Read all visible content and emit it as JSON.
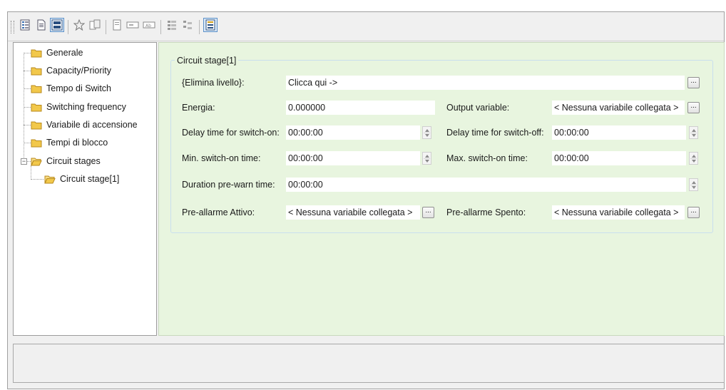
{
  "toolbar": {
    "buttons": [
      "tree-view-icon",
      "document-icon",
      "panel-view-icon",
      "star-icon",
      "copy-icon",
      "page-icon",
      "field-icon",
      "field-abc-icon",
      "tree-expand-icon",
      "tree-collapse-icon",
      "table-icon"
    ]
  },
  "tree": {
    "items": [
      {
        "label": "Generale"
      },
      {
        "label": "Capacity/Priority"
      },
      {
        "label": "Tempo di Switch"
      },
      {
        "label": "Switching frequency"
      },
      {
        "label": "Variabile di accensione"
      },
      {
        "label": "Tempi di blocco"
      },
      {
        "label": "Circuit stages",
        "expander": "−"
      },
      {
        "label": "Circuit stage[1]"
      }
    ]
  },
  "form": {
    "group_title": "Circuit stage[1]",
    "elimina_label": "{Elimina livello}:",
    "elimina_value": "Clicca qui ->",
    "energia_label": "Energia:",
    "energia_value": "0.000000",
    "output_label": "Output variable:",
    "output_value": "< Nessuna variabile collegata >",
    "delay_on_label": "Delay time for switch-on:",
    "delay_on_value": "00:00:00",
    "delay_off_label": "Delay time for switch-off:",
    "delay_off_value": "00:00:00",
    "min_on_label": "Min. switch-on time:",
    "min_on_value": "00:00:00",
    "max_on_label": "Max. switch-on time:",
    "max_on_value": "00:00:00",
    "prewarn_label": "Duration pre-warn time:",
    "prewarn_value": "00:00:00",
    "pre_attivo_label": "Pre-allarme Attivo:",
    "pre_attivo_value": "< Nessuna variabile collegata >",
    "pre_spento_label": "Pre-allarme Spento:",
    "pre_spento_value": "< Nessuna variabile collegata >",
    "browse_button": "..."
  },
  "colors": {
    "content_bg": "#e8f5df",
    "folder": "#f2c84b",
    "active_toolbar": "#5b8fc7"
  }
}
